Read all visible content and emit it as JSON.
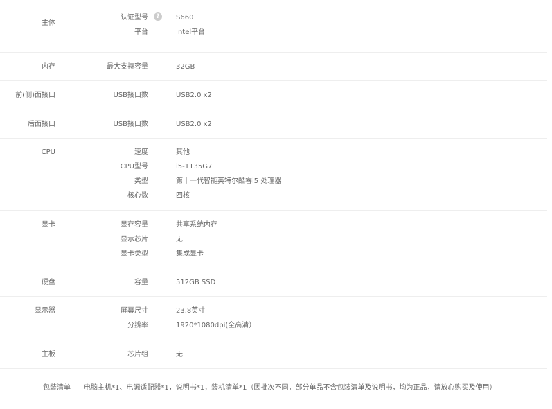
{
  "sections": {
    "main": {
      "title": "主体",
      "rows": [
        {
          "label": "认证型号",
          "value": "S660",
          "help_icon": "question-circle-icon"
        },
        {
          "label": "平台",
          "value": "Intel平台"
        }
      ]
    },
    "memory": {
      "title": "内存",
      "rows": [
        {
          "label": "最大支持容量",
          "value": "32GB"
        }
      ]
    },
    "front_ports": {
      "title": "前(侧)面接口",
      "rows": [
        {
          "label": "USB接口数",
          "value": "USB2.0 x2"
        }
      ]
    },
    "rear_ports": {
      "title": "后面接口",
      "rows": [
        {
          "label": "USB接口数",
          "value": "USB2.0 x2"
        }
      ]
    },
    "cpu": {
      "title": "CPU",
      "rows": [
        {
          "label": "速度",
          "value": "其他"
        },
        {
          "label": "CPU型号",
          "value": "i5-1135G7"
        },
        {
          "label": "类型",
          "value": "第十一代智能英特尔酷睿i5 处理器"
        },
        {
          "label": "核心数",
          "value": "四核"
        }
      ]
    },
    "gpu": {
      "title": "显卡",
      "rows": [
        {
          "label": "显存容量",
          "value": "共享系统内存"
        },
        {
          "label": "显示芯片",
          "value": "无"
        },
        {
          "label": "显卡类型",
          "value": "集成显卡"
        }
      ]
    },
    "disk": {
      "title": "硬盘",
      "rows": [
        {
          "label": "容量",
          "value": "512GB SSD"
        }
      ]
    },
    "display": {
      "title": "显示器",
      "rows": [
        {
          "label": "屏幕尺寸",
          "value": "23.8英寸"
        },
        {
          "label": "分辨率",
          "value": "1920*1080dpi(全高清）"
        }
      ]
    },
    "board": {
      "title": "主板",
      "rows": [
        {
          "label": "芯片组",
          "value": "无"
        }
      ]
    },
    "package": {
      "title": "包装清单",
      "value": "电脑主机*1、电源适配器*1，说明书*1，装机清单*1（因批次不同，部分单品不含包装清单及说明书，均为正品，请放心购买及使用）"
    }
  },
  "help_icon_glyph": "?",
  "colors": {
    "text": "#666666",
    "divider": "#eeeeee",
    "help_icon_bg": "#cccccc"
  }
}
